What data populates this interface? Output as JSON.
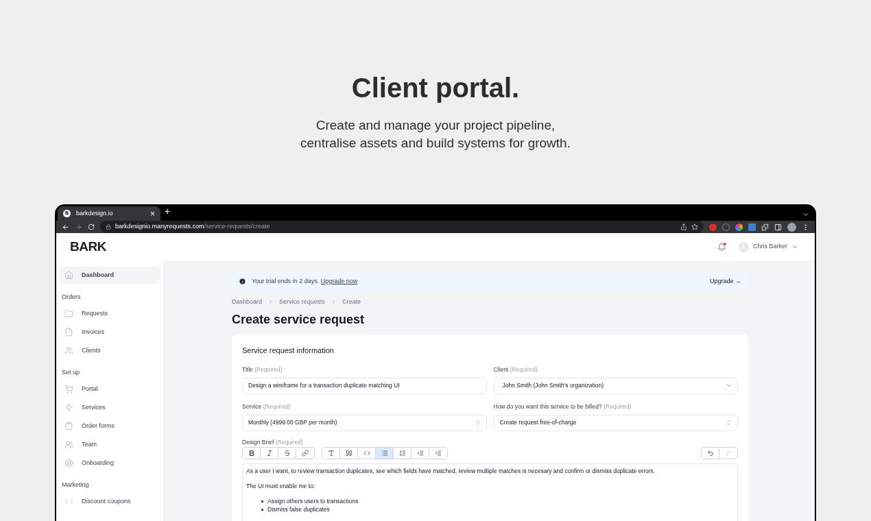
{
  "hero": {
    "title": "Client portal.",
    "subtitle_lines": [
      "Create and manage your project pipeline,",
      "centralise assets and build systems for growth."
    ]
  },
  "browser": {
    "tab": {
      "favicon": "B",
      "title": "barkdesign.io",
      "close": "×"
    },
    "new_tab": "+",
    "url_host": "barkdesignio.manyrequests.com",
    "url_path": "/service-requests/create"
  },
  "app": {
    "logo": "BARK",
    "notifications": {
      "unread": true
    },
    "user": {
      "name": "Chris Barker"
    },
    "sidebar": {
      "top": {
        "label": "Dashboard",
        "kind": "home",
        "selected": true
      },
      "groups": [
        {
          "heading": "Orders",
          "items": [
            {
              "label": "Requests",
              "kind": "folder",
              "selected": false
            },
            {
              "label": "Invoices",
              "kind": "file",
              "selected": false
            },
            {
              "label": "Clients",
              "kind": "users",
              "selected": false
            }
          ]
        },
        {
          "heading": "Set up",
          "items": [
            {
              "label": "Portal",
              "kind": "cart",
              "selected": false
            },
            {
              "label": "Services",
              "kind": "bolt",
              "selected": false
            },
            {
              "label": "Order forms",
              "kind": "clipboard",
              "selected": false
            },
            {
              "label": "Team",
              "kind": "team",
              "selected": false
            },
            {
              "label": "Onboarding",
              "kind": "lifebuoy",
              "selected": false
            }
          ]
        },
        {
          "heading": "Marketing",
          "items": [
            {
              "label": "Discount coupons",
              "kind": "code",
              "selected": false
            }
          ]
        }
      ]
    },
    "banner": {
      "text": "Your trial ends in 2 days.",
      "link": "Upgrade now",
      "action": "Upgrade →"
    },
    "breadcrumb": [
      "Dashboard",
      "Service requests",
      "Create"
    ],
    "page_title": "Create service request",
    "card": {
      "title": "Service request information",
      "fields": [
        {
          "label": "Title",
          "required": "(Required)",
          "value": "Design a wireframe for a transaction duplicate matching UI",
          "kind": "text"
        },
        {
          "label": "Client",
          "required": "(Required)",
          "value": "John Smith (John Smith's organization)",
          "kind": "dropdown"
        },
        {
          "label": "Service",
          "required": "(Required)",
          "value": "Monthly (4999.00 GBP per month)",
          "kind": "select"
        },
        {
          "label": "How do you want this service to be billed?",
          "required": "(Required)",
          "value": "Create request free-of-charge",
          "kind": "select"
        }
      ],
      "editor": {
        "label": "Design Brief",
        "required": "(Required)",
        "toolbar": [
          [
            {
              "kind": "bold",
              "selected": false,
              "disabled": false
            },
            {
              "kind": "italic",
              "selected": false,
              "disabled": false
            },
            {
              "kind": "strike",
              "selected": false,
              "disabled": false
            },
            {
              "kind": "link",
              "selected": false,
              "disabled": false
            }
          ],
          [
            {
              "kind": "heading",
              "selected": false,
              "disabled": false
            },
            {
              "kind": "quote",
              "selected": false,
              "disabled": false
            },
            {
              "kind": "code",
              "selected": false,
              "disabled": false
            },
            {
              "kind": "bullets",
              "selected": true,
              "disabled": false
            },
            {
              "kind": "numbers",
              "selected": false,
              "disabled": false
            },
            {
              "kind": "outdent",
              "selected": false,
              "disabled": false
            },
            {
              "kind": "indent",
              "selected": false,
              "disabled": false
            }
          ]
        ],
        "history": [
          {
            "kind": "undo",
            "selected": false,
            "disabled": false
          },
          {
            "kind": "redo",
            "selected": false,
            "disabled": true
          }
        ],
        "paragraphs": [
          "As a user I want, to review transaction duplicates, see which fields have matched, review multiple matches is necesary and confirm or dismiss duplicate errors.",
          "The UI must enable me to:"
        ],
        "bullets": [
          "Assign others users to transactions",
          "Dismiss false duplicates"
        ]
      }
    }
  }
}
